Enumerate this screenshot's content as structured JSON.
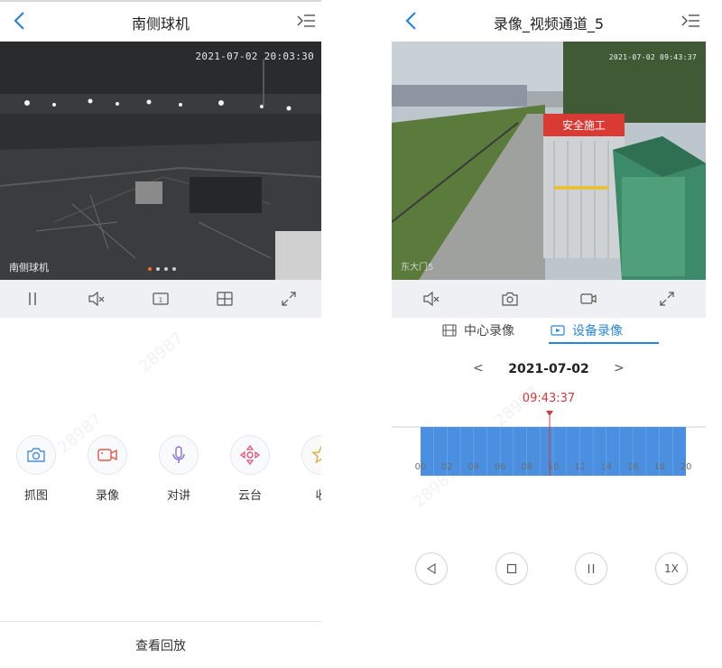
{
  "left": {
    "title": "南侧球机",
    "video": {
      "timestamp": "2021-07-02 20:03:30",
      "channel_label": "南侧球机",
      "page_count": 4,
      "active_page": 1
    },
    "controls": [
      "pause-icon",
      "mute-icon",
      "stream-quality-icon",
      "grid-layout-icon",
      "fullscreen-icon"
    ],
    "functions": [
      {
        "label": "抓图",
        "icon": "camera-icon",
        "color": "#4a90d9"
      },
      {
        "label": "录像",
        "icon": "video-record-icon",
        "color": "#e2584c"
      },
      {
        "label": "对讲",
        "icon": "microphone-icon",
        "color": "#8b6fd6"
      },
      {
        "label": "云台",
        "icon": "ptz-direction-icon",
        "color": "#e0557a"
      },
      {
        "label": "收",
        "icon": "star-icon",
        "color": "#e8a93a"
      }
    ],
    "bottom_button": "查看回放"
  },
  "right": {
    "title": "录像_视频通道_5",
    "video": {
      "timestamp": "2021-07-02 09:43:37",
      "channel_label": "东大门5",
      "sign_text": "安全施工"
    },
    "controls": [
      "mute-icon",
      "snapshot-icon",
      "record-icon",
      "fullscreen-icon"
    ],
    "tabs": [
      {
        "label": "中心录像",
        "icon": "film-icon",
        "active": false
      },
      {
        "label": "设备录像",
        "icon": "device-video-icon",
        "active": true
      }
    ],
    "date": {
      "prev": "<",
      "value": "2021-07-02",
      "next": ">"
    },
    "current_time": "09:43:37",
    "timeline": {
      "tick_labels": [
        "00",
        "02",
        "04",
        "06",
        "08",
        "10",
        "12",
        "14",
        "16",
        "18",
        "20"
      ],
      "recorded_range_hours": [
        0,
        20
      ],
      "cursor_hour": 9.73,
      "bar_color": "#4a8fe0",
      "cursor_color": "#d23a3a"
    },
    "playback": [
      "prev-icon",
      "stop-icon",
      "pause-icon",
      "1X"
    ]
  },
  "accent_color": "#2a86d8"
}
